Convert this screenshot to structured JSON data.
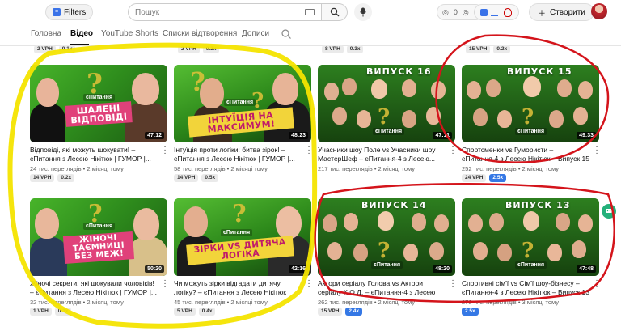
{
  "header": {
    "filters_label": "Filters",
    "search_placeholder": "Пошук",
    "ext_counts": [
      "0",
      "0"
    ],
    "create_label": "Створити"
  },
  "tabs": [
    {
      "label": "Головна",
      "active": false
    },
    {
      "label": "Відео",
      "active": true
    },
    {
      "label": "YouTube Shorts",
      "active": false
    },
    {
      "label": "Списки відтворення",
      "active": false
    },
    {
      "label": "Дописи",
      "active": false
    }
  ],
  "prev_row_stats": [
    {
      "vph": "2 VPH",
      "ratio": "0.1x"
    },
    {
      "vph": "2 VPH",
      "ratio": "0.2x"
    },
    {
      "vph": "8 VPH",
      "ratio": "0.3x"
    },
    {
      "vph": "15 VPH",
      "ratio": "0.2x"
    }
  ],
  "videos": [
    {
      "title": "Відповіді, які можуть шокувати! – єПитання з Лесею Нікітюк | ГУМОР |...",
      "views": "24 тис. переглядів",
      "age": "2 місяці тому",
      "duration": "47:12",
      "caption": "ШАЛЕНІ ВІДПОВІДІ",
      "logo": "єПитання",
      "vph": "14 VPH",
      "ratio": "0.2x",
      "ratio_highlight": false
    },
    {
      "title": "Інтуїція проти логіки: битва зірок! – єПитання з Лесею Нікітюк | ГУМОР |...",
      "views": "58 тис. переглядів",
      "age": "2 місяці тому",
      "duration": "48:23",
      "caption": "ІНТУЇЦІЯ НА МАКСИМУМ!",
      "logo": "єПитання",
      "vph": "14 VPH",
      "ratio": "0.5x",
      "ratio_highlight": false
    },
    {
      "title": "Учасники шоу Поле vs Учасники шоу МастерШеф – єПитання-4 з Лесею...",
      "views": "217 тис. переглядів",
      "age": "2 місяці тому",
      "duration": "47:11",
      "caption": "ВИПУСК 16",
      "logo": "єПитання",
      "vph": "",
      "ratio": "",
      "ratio_highlight": false
    },
    {
      "title": "Спортсменки vs Гумористи – єПитання-4 з Лесею Нікітюк – Випуск 15",
      "views": "252 тис. переглядів",
      "age": "2 місяці тому",
      "duration": "49:33",
      "caption": "ВИПУСК 15",
      "logo": "єПитання",
      "vph": "24 VPH",
      "ratio": "2.5x",
      "ratio_highlight": true
    },
    {
      "title": "Жіночі секрети, які шокували чоловіків! – єПитання з Лесею Нікітюк | ГУМОР |...",
      "views": "32 тис. переглядів",
      "age": "2 місяці тому",
      "duration": "50:20",
      "caption": "ЖІНОЧІ ТАЄМНИЦІ БЕЗ МЕЖ!",
      "logo": "єПитання",
      "vph": "1 VPH",
      "ratio": "0.1x",
      "ratio_highlight": false
    },
    {
      "title": "Чи можуть зірки відгадати дитячу логіку? – єПитання з Лесею Нікітюк | ГУМОР |...",
      "views": "45 тис. переглядів",
      "age": "2 місяці тому",
      "duration": "42:16",
      "caption": "ЗІРКИ VS ДИТЯЧА ЛОГІКА",
      "logo": "єПитання",
      "vph": "5 VPH",
      "ratio": "0.4x",
      "ratio_highlight": false
    },
    {
      "title": "Актори серіалу Голова vs Актори серіалу К.О.Д. – єПитання-4 з Лесею Нікітюк...",
      "views": "262 тис. переглядів",
      "age": "2 місяці тому",
      "duration": "48:20",
      "caption": "ВИПУСК 14",
      "logo": "єПитання",
      "vph": "15 VPH",
      "ratio": "2.4x",
      "ratio_highlight": true
    },
    {
      "title": "Спортивні сім'ї vs Сім'ї шоу-бізнесу – єПитання-4 з Лесею Нікітюк – Випуск 13",
      "views": "278 тис. переглядів",
      "age": "3 місяці тому",
      "duration": "47:48",
      "caption": "ВИПУСК 13",
      "logo": "єПитання",
      "vph": "",
      "ratio": "2.5x",
      "ratio_highlight": true
    }
  ],
  "colors": {
    "annotation_yellow": "#f4e400",
    "annotation_red": "#d4141b",
    "accent_blue": "#3578e5",
    "thumb_green": "#2f9a1f"
  }
}
